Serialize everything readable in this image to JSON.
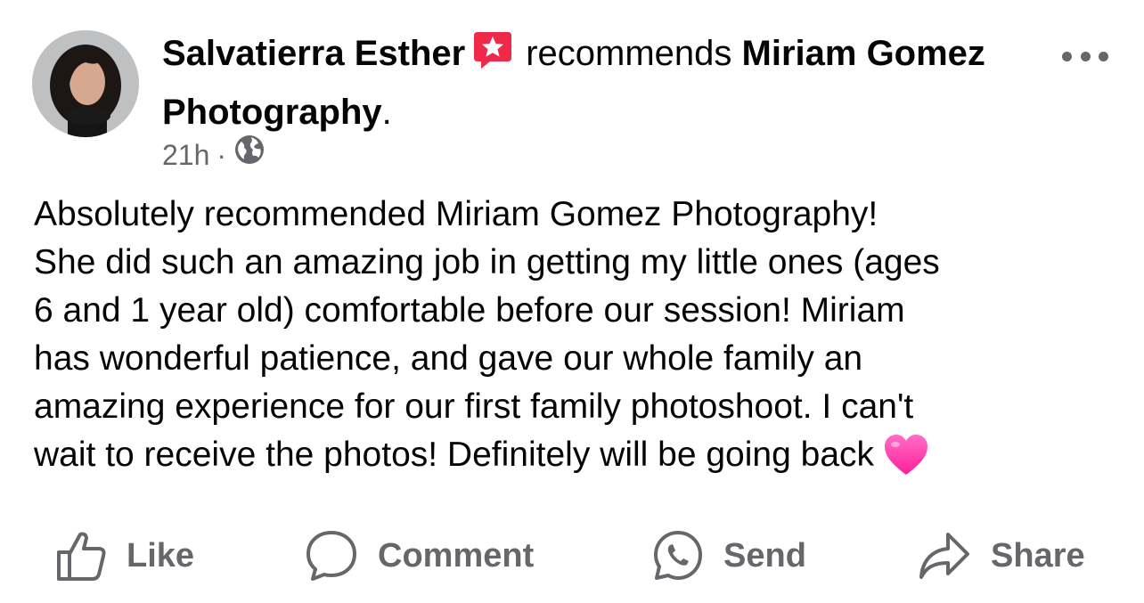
{
  "post": {
    "author": "Salvatierra Esther",
    "verb": "recommends",
    "page_name": "Miriam Gomez Photography",
    "period": ".",
    "time": "21h",
    "separator": "·",
    "audience_icon": "globe-icon",
    "recommend_icon": "recommend-star-icon",
    "more_icon": "more-options-icon",
    "text": "Absolutely recommended Miriam Gomez Photography!\nShe did such an amazing job in getting my little ones (ages\n6 and 1 year old) comfortable before our session! Miriam\nhas wonderful patience, and gave our whole family an\namazing experience for our first family photoshoot. I can't\nwait to receive the photos! Definitely will be going back",
    "emoji": "pink-heart-icon"
  },
  "actions": {
    "like": "Like",
    "comment": "Comment",
    "send": "Send",
    "share": "Share"
  },
  "colors": {
    "text": "#050505",
    "secondary": "#65676b",
    "recommend_red": "#f0284a",
    "heart_pink": "#ff2ea8"
  }
}
